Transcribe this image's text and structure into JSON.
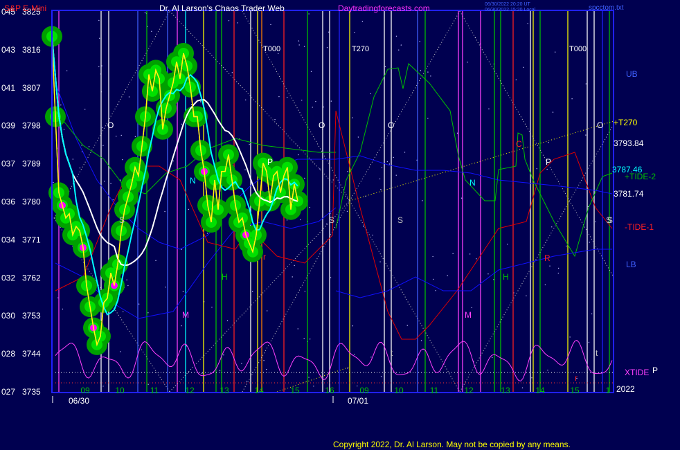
{
  "header": {
    "instrument": "S&P E-Mini",
    "title": "Dr. Al Larson's Chaos Trader Web",
    "site": "Daytradingforecasts.com",
    "stamp_line1": "06/30/2022 20:20 UT",
    "stamp_line2": "06/30/2022 15:20 Local",
    "filename": "spcctom.txt"
  },
  "footer": {
    "copyright": "Copyright 2022, Dr. Al Larson. May not be copied by any means.",
    "year": "2022"
  },
  "colors": {
    "background": "#000050",
    "plot_bg": "#000050",
    "frame": "#2020ff",
    "price_line": "#ffff00",
    "raw_price": "#ff30ff",
    "ma_fast": "#00ffff",
    "ma_slow": "#ffffff",
    "tide_green": "#00c000",
    "tide_red": "#e00000",
    "band_blue": "#1010ff",
    "xtide": "#ff40ff",
    "forecast": "#ffff00"
  },
  "chart_data": {
    "type": "line",
    "y_ticks": [
      {
        "left": "045",
        "price": "3825"
      },
      {
        "left": "043",
        "price": "3816"
      },
      {
        "left": "041",
        "price": "3807"
      },
      {
        "left": "039",
        "price": "3798"
      },
      {
        "left": "037",
        "price": "3789"
      },
      {
        "left": "036",
        "price": "3780"
      },
      {
        "left": "034",
        "price": "3771"
      },
      {
        "left": "032",
        "price": "3762"
      },
      {
        "left": "030",
        "price": "3753"
      },
      {
        "left": "028",
        "price": "3744"
      },
      {
        "left": "027",
        "price": "3735"
      }
    ],
    "ylim": [
      3735,
      3825
    ],
    "x_hours": [
      "09",
      "10",
      "11",
      "12",
      "13",
      "14",
      "15",
      "16",
      "09",
      "10",
      "11",
      "12",
      "13",
      "14",
      "15",
      "1"
    ],
    "dates": [
      "06/30",
      "07/01"
    ],
    "top_labels": [
      "T000",
      "T270",
      "T000"
    ],
    "right_labels": {
      "ub": "UB",
      "lb": "LB",
      "t270": "+T270",
      "p1": "3793.84",
      "p2": "3787.46",
      "p3": "3781.74",
      "tide2": "+TIDE-2",
      "tide1": "-TIDE-1",
      "xtide": "XTIDE",
      "p": "P"
    },
    "markers": [
      "O",
      "O",
      "O",
      "O",
      "S",
      "S",
      "S",
      "S",
      "S",
      "P",
      "P",
      "N",
      "N",
      "H",
      "H",
      "M",
      "M",
      "r",
      "r",
      "R",
      "C",
      "t",
      "t"
    ],
    "series": [
      {
        "values_x": [
          0.0,
          0.1,
          0.2,
          0.3,
          0.4,
          0.5,
          0.6,
          0.7,
          0.8,
          0.9,
          1.0,
          1.1,
          1.2,
          1.3,
          1.4,
          1.5,
          1.6,
          1.7,
          1.8,
          1.9,
          2.0,
          2.1,
          2.2,
          2.3,
          2.4,
          2.5,
          2.6,
          2.7,
          2.8,
          2.9,
          3.0,
          3.1,
          3.2,
          3.3,
          3.4,
          3.5,
          3.6,
          3.7,
          3.8,
          3.9,
          4.0,
          4.1,
          4.2,
          4.3,
          4.4,
          4.5,
          4.6,
          4.7,
          4.8,
          4.9,
          5.0,
          5.1,
          5.2,
          5.3,
          5.4,
          5.5,
          5.6,
          5.7,
          5.8,
          5.9,
          6.0,
          6.1,
          6.2,
          6.3,
          6.4,
          6.5,
          6.6,
          6.7,
          6.8,
          6.9,
          7.0,
          7.1
        ],
        "values": [
          3819,
          3800,
          3782,
          3779,
          3776,
          3777,
          3772,
          3774,
          3773,
          3769,
          3760,
          3755,
          3750,
          3746,
          3748,
          3756,
          3757,
          3763,
          3760,
          3765,
          3773,
          3778,
          3781,
          3784,
          3788,
          3786,
          3793,
          3800,
          3810,
          3806,
          3811,
          3809,
          3797,
          3802,
          3805,
          3808,
          3813,
          3809,
          3815,
          3812,
          3807,
          3800,
          3800,
          3792,
          3787,
          3779,
          3775,
          3785,
          3778,
          3787,
          3787,
          3791,
          3785,
          3779,
          3775,
          3776,
          3772,
          3770,
          3768,
          3772,
          3780,
          3789,
          3787,
          3780,
          3786,
          3787,
          3782,
          3786,
          3788,
          3778,
          3784,
          3780
        ]
      }
    ]
  }
}
